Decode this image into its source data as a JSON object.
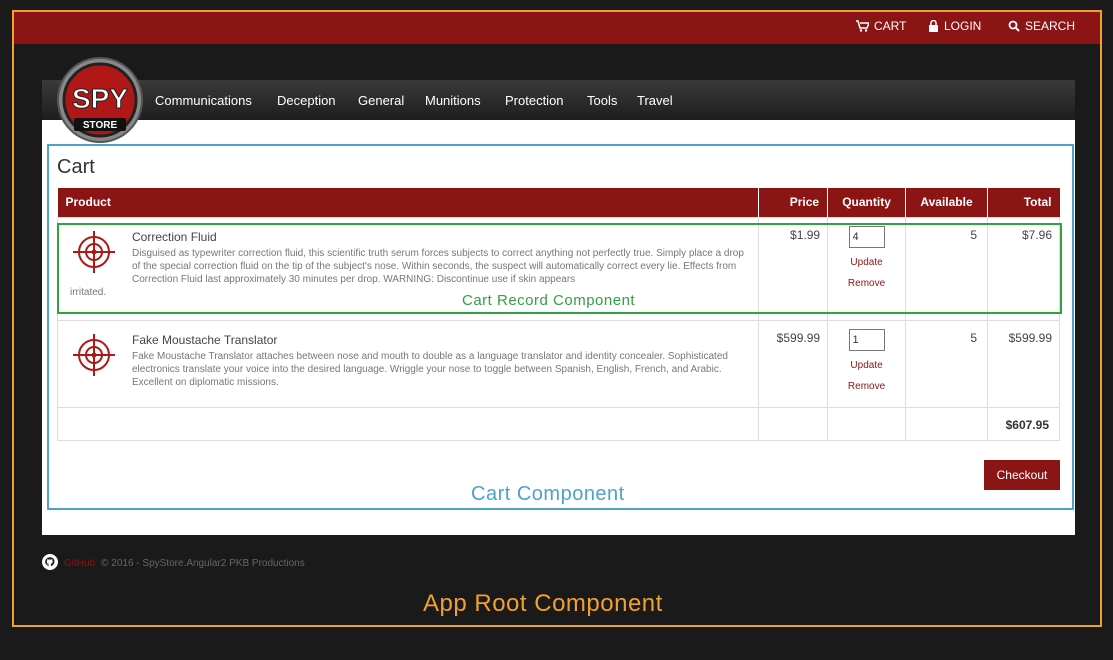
{
  "topbar": {
    "cart_label": "CART",
    "login_label": "LOGIN",
    "search_label": "SEARCH"
  },
  "logo": {
    "text_main": "SPY",
    "text_sub": "STORE"
  },
  "nav": {
    "items": [
      "Communications",
      "Deception",
      "General",
      "Munitions",
      "Protection",
      "Tools",
      "Travel"
    ]
  },
  "cart": {
    "title": "Cart",
    "columns": {
      "product": "Product",
      "price": "Price",
      "quantity": "Quantity",
      "available": "Available",
      "total": "Total"
    },
    "items": [
      {
        "name": "Correction Fluid",
        "description": "Disguised as typewriter correction fluid, this scientific truth serum forces subjects to correct anything not perfectly true. Simply place a drop of the special correction fluid on the tip of the subject's nose. Within seconds, the suspect will automatically correct every lie. Effects from Correction Fluid last approximately 30 minutes per drop. WARNING: Discontinue use if skin appears",
        "description_tail": "irritated.",
        "price": "$1.99",
        "quantity": "4",
        "available": "5",
        "total": "$7.96",
        "update_label": "Update",
        "remove_label": "Remove"
      },
      {
        "name": "Fake Moustache Translator",
        "description": "Fake Moustache Translator attaches between nose and mouth to double as a language translator and identity concealer. Sophisticated electronics translate your voice into the desired language. Wriggle your nose to toggle between Spanish, English, French, and Arabic. Excellent on diplomatic missions.",
        "description_tail": "",
        "price": "$599.99",
        "quantity": "1",
        "available": "5",
        "total": "$599.99",
        "update_label": "Update",
        "remove_label": "Remove"
      }
    ],
    "grand_total": "$607.95",
    "checkout_label": "Checkout"
  },
  "annotations": {
    "record_component": "Cart Record Component",
    "cart_component": "Cart Component",
    "app_root_component": "App Root Component"
  },
  "footer": {
    "github_label": "GitHub",
    "copyright": "© 2016 - SpyStore.Angular2 PKB Productions"
  },
  "colors": {
    "brand_red": "#8b1414",
    "app_frame": "#f0a030",
    "cart_frame": "#4ba3c8",
    "record_frame": "#33a041"
  }
}
